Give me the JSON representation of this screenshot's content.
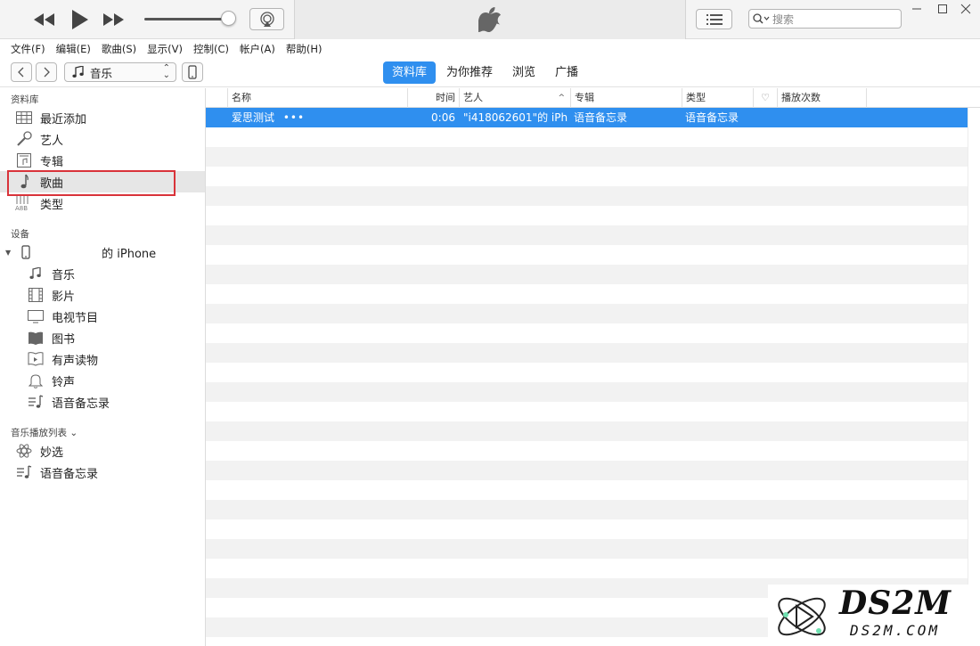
{
  "search": {
    "placeholder": "搜索"
  },
  "menu": [
    "文件(F)",
    "编辑(E)",
    "歌曲(S)",
    "显示(V)",
    "控制(C)",
    "帐户(A)",
    "帮助(H)"
  ],
  "nav": {
    "media_label": "音乐",
    "tabs": [
      {
        "label": "资料库",
        "active": true
      },
      {
        "label": "为你推荐",
        "active": false
      },
      {
        "label": "浏览",
        "active": false
      },
      {
        "label": "广播",
        "active": false
      }
    ]
  },
  "sidebar": {
    "library_title": "资料库",
    "library_items": [
      {
        "label": "最近添加",
        "icon": "grid-icon"
      },
      {
        "label": "艺人",
        "icon": "microphone-icon"
      },
      {
        "label": "专辑",
        "icon": "album-icon"
      },
      {
        "label": "歌曲",
        "icon": "note-icon",
        "selected": true
      },
      {
        "label": "类型",
        "icon": "genre-icon"
      }
    ],
    "devices_title": "设备",
    "device_name": "的 iPhone",
    "device_items": [
      {
        "label": "音乐",
        "icon": "music-note-icon"
      },
      {
        "label": "影片",
        "icon": "film-icon"
      },
      {
        "label": "电视节目",
        "icon": "tv-icon"
      },
      {
        "label": "图书",
        "icon": "book-icon"
      },
      {
        "label": "有声读物",
        "icon": "audiobook-icon"
      },
      {
        "label": "铃声",
        "icon": "bell-icon"
      },
      {
        "label": "语音备忘录",
        "icon": "voice-memo-icon"
      }
    ],
    "playlists_title": "音乐播放列表 ⌄",
    "playlist_items": [
      {
        "label": "妙选",
        "icon": "atom-icon"
      },
      {
        "label": "语音备忘录",
        "icon": "playlist-icon"
      }
    ]
  },
  "table": {
    "headers": {
      "name": "名称",
      "time": "时间",
      "artist": "艺人",
      "album": "专辑",
      "genre": "类型",
      "plays": "播放次数"
    },
    "rows": [
      {
        "name": "爱思测试",
        "more": "•••",
        "time": "0:06",
        "artist": "\"i418062601\"的 iPh...",
        "album": "语音备忘录",
        "genre": "语音备忘录"
      }
    ]
  },
  "watermark": {
    "text": "DS2M",
    "url": "DS2M.COM"
  },
  "colors": {
    "accent": "#2f8fef",
    "highlight_border": "#d9333a"
  }
}
